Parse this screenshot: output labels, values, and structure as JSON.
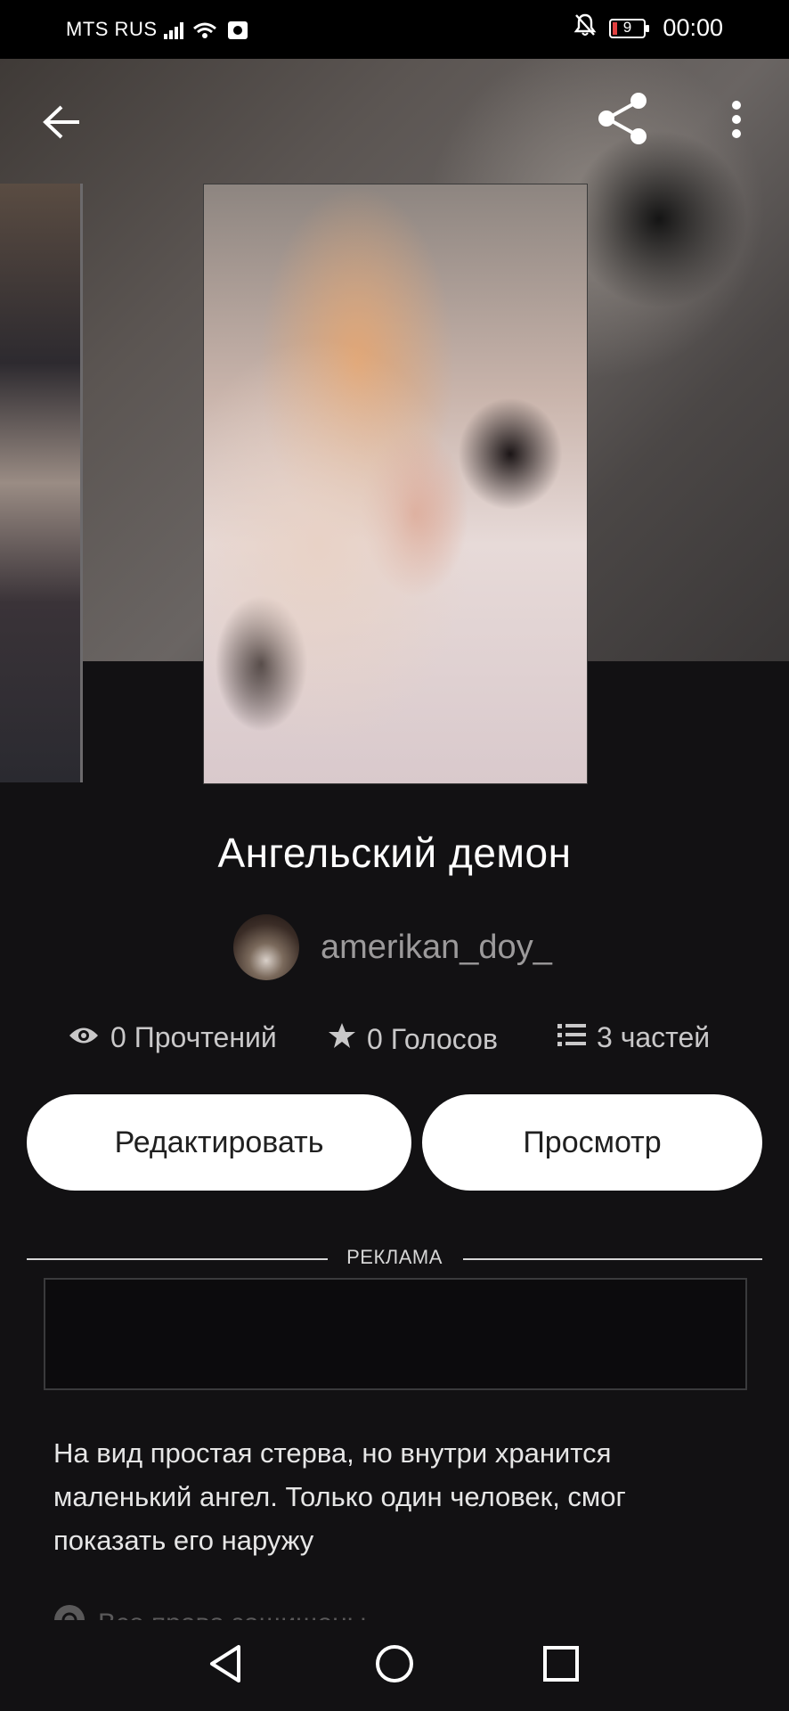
{
  "status_bar": {
    "carrier": "MTS RUS",
    "battery": "9",
    "time": "00:00"
  },
  "story": {
    "title": "Ангельский демон",
    "author": "amerikan_doy_",
    "reads": "0 Прочтений",
    "votes": "0 Голосов",
    "parts": "3 частей",
    "description": "На вид простая стерва, но внутри хранится маленький ангел. Только один человек, смог показать его наружу",
    "copyright": "Все права защищены"
  },
  "actions": {
    "edit_label": "Редактировать",
    "view_label": "Просмотр"
  },
  "ad": {
    "label": "РЕКЛАМА"
  },
  "icons": {
    "back": "arrow-left-icon",
    "share": "share-icon",
    "more": "more-vert-icon",
    "reads": "eye-icon",
    "votes": "star-icon",
    "parts": "list-icon"
  }
}
